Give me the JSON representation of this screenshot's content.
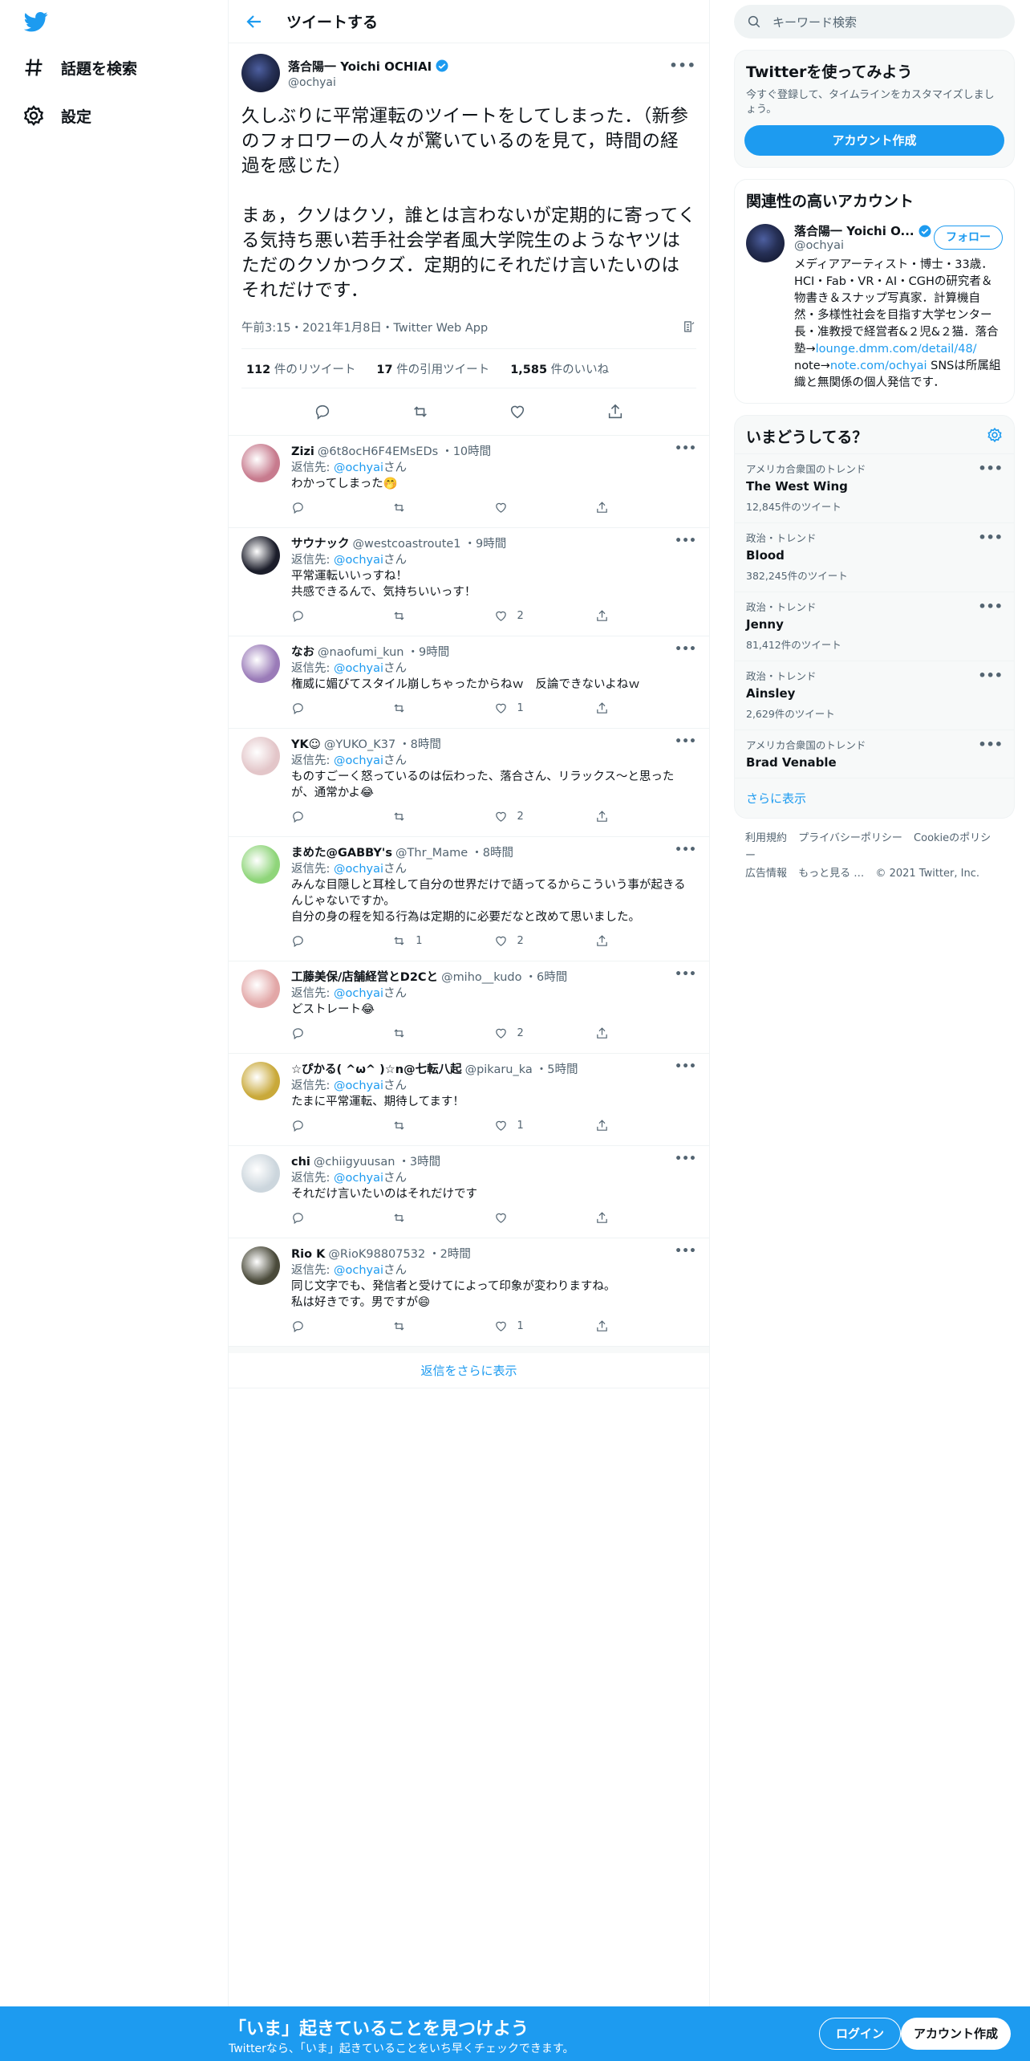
{
  "nav": {
    "explore": "話題を検索",
    "settings": "設定"
  },
  "header": {
    "title": "ツイートする"
  },
  "tweet": {
    "name": "落合陽一 Yoichi OCHIAI",
    "handle": "@ochyai",
    "text": "久しぶりに平常運転のツイートをしてしまった．（新参のフォロワーの人々が驚いているのを見て，時間の経過を感じた）\n\nまぁ，クソはクソ，誰とは言わないが定期的に寄ってくる気持ち悪い若手社会学者風大学院生のようなヤツはただのクソかつクズ．定期的にそれだけ言いたいのはそれだけです．",
    "time": "午前3:15・2021年1月8日・Twitter Web App",
    "retweets": "112",
    "retweets_label": "件のリツイート",
    "quotes": "17",
    "quotes_label": "件の引用ツイート",
    "likes": "1,585",
    "likes_label": "件のいいね"
  },
  "reply_prefix": "返信先: ",
  "reply_to": "@ochyai",
  "reply_suffix": "さん",
  "replies": [
    {
      "name": "Zizi",
      "handle": "@6t8ocH6F4EMsEDs",
      "time": "・10時間",
      "text": "わかってしまった🤭",
      "rt": "",
      "like": "",
      "color": "#c77b8e"
    },
    {
      "name": "サウナック",
      "handle": "@westcoastroute1",
      "time": "・9時間",
      "text": "平常運転いいっすね！\n共感できるんで、気持ちいいっす！",
      "rt": "",
      "like": "2",
      "color": "#1b1d2a"
    },
    {
      "name": "なお",
      "handle": "@naofumi_kun",
      "time": "・9時間",
      "text": "権威に媚びてスタイル崩しちゃったからねｗ　反論できないよねｗ",
      "rt": "",
      "like": "1",
      "color": "#9a7bb8"
    },
    {
      "name": "YK☺",
      "handle": "@YUKO_K37",
      "time": "・8時間",
      "text": "ものすごーく怒っているのは伝わった、落合さん、リラックス〜と思ったが、通常かよ😂",
      "rt": "",
      "like": "2",
      "color": "#e3c6c9"
    },
    {
      "name": "まめた@GABBY's",
      "handle": "@Thr_Mame",
      "time": "・8時間",
      "text": "みんな目隠しと耳栓して自分の世界だけで語ってるからこういう事が起きるんじゃないですか。\n自分の身の程を知る行為は定期的に必要だなと改めて思いました。",
      "rt": "1",
      "like": "2",
      "color": "#8fd57a"
    },
    {
      "name": "工藤美保/店舗経営とD2Cと",
      "handle": "@miho__kudo",
      "time": "・6時間",
      "text": "どストレート😂",
      "rt": "",
      "like": "2",
      "color": "#e2a7a7"
    },
    {
      "name": "☆ぴかる( ^ω^ )☆n@七転八起",
      "handle": "@pikaru_ka",
      "time": "・5時間",
      "text": "たまに平常運転、期待してます！",
      "rt": "",
      "like": "1",
      "color": "#c9a93a"
    },
    {
      "name": "chi",
      "handle": "@chiigyuusan",
      "time": "・3時間",
      "text": "それだけ言いたいのはそれだけです",
      "rt": "",
      "like": "",
      "color": "#ccd6dd"
    },
    {
      "name": "Rio K",
      "handle": "@RioK98807532",
      "time": "・2時間",
      "text": "同じ文字でも、発信者と受けてによって印象が変わりますね。\n私は好きです。男ですが😄",
      "rt": "",
      "like": "1",
      "color": "#4a4a3a"
    }
  ],
  "show_more_replies": "返信をさらに表示",
  "search": {
    "placeholder": "キーワード検索"
  },
  "signup": {
    "title": "Twitterを使ってみよう",
    "sub": "今すぐ登録して、タイムラインをカスタマイズしましょう。",
    "button": "アカウント作成"
  },
  "related": {
    "title": "関連性の高いアカウント",
    "name": "落合陽一 Yoichi O...",
    "handle": "@ochyai",
    "follow": "フォロー",
    "bio_1": "メディアアーティスト・博士・33歳．HCI・Fab・VR・AI・CGHの研究者＆物書き＆スナップ写真家．計算機自然・多様性社会を目指す大学センター長・准教授で経営者&２児&２猫．落合塾→",
    "bio_link_1": "lounge.dmm.com/detail/48/",
    "bio_2": " note→",
    "bio_link_2": "note.com/ochyai",
    "bio_3": " SNSは所属組織と無関係の個人発信です．"
  },
  "trends": {
    "title": "いまどうしてる？",
    "items": [
      {
        "context": "アメリカ合衆国のトレンド",
        "name": "The West Wing",
        "count": "12,845件のツイート"
      },
      {
        "context": "政治・トレンド",
        "name": "Blood",
        "count": "382,245件のツイート"
      },
      {
        "context": "政治・トレンド",
        "name": "Jenny",
        "count": "81,412件のツイート"
      },
      {
        "context": "政治・トレンド",
        "name": "Ainsley",
        "count": "2,629件のツイート"
      },
      {
        "context": "アメリカ合衆国のトレンド",
        "name": "Brad Venable",
        "count": ""
      }
    ],
    "more": "さらに表示"
  },
  "footer": {
    "terms": "利用規約",
    "privacy": "プライバシーポリシー",
    "cookie": "Cookieのポリシー",
    "ads": "広告情報",
    "more": "もっと見る …",
    "copyright": "© 2021 Twitter, Inc."
  },
  "bottombar": {
    "title": "「いま」起きていることを見つけよう",
    "sub": "Twitterなら、「いま」起きていることをいち早くチェックできます。",
    "login": "ログイン",
    "signup": "アカウント作成"
  },
  "colors": {
    "accent": "#1d9bf0",
    "text": "#0f1419",
    "muted": "#536471"
  }
}
